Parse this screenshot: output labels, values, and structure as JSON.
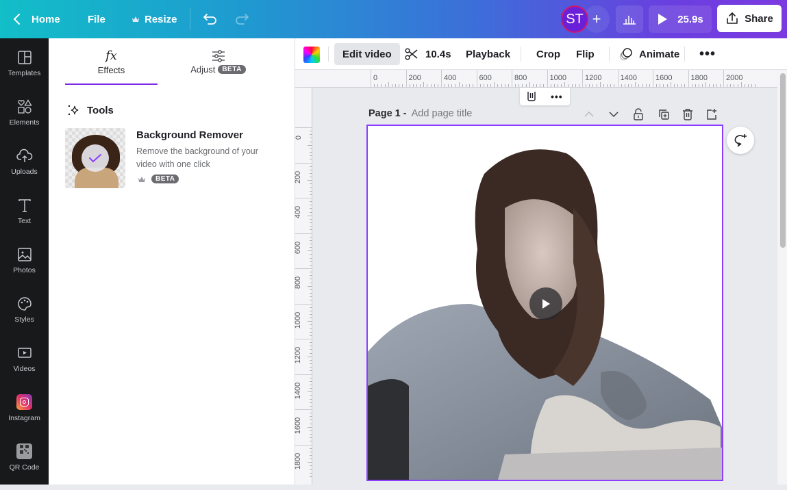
{
  "topbar": {
    "home_label": "Home",
    "file_label": "File",
    "resize_label": "Resize",
    "avatar_initials": "ST",
    "play_duration": "25.9s",
    "share_label": "Share"
  },
  "sidebar": {
    "items": [
      {
        "label": "Templates",
        "icon": "templates-icon"
      },
      {
        "label": "Elements",
        "icon": "elements-icon"
      },
      {
        "label": "Uploads",
        "icon": "upload-cloud-icon"
      },
      {
        "label": "Text",
        "icon": "text-icon"
      },
      {
        "label": "Photos",
        "icon": "photos-icon"
      },
      {
        "label": "Styles",
        "icon": "palette-icon"
      },
      {
        "label": "Videos",
        "icon": "video-icon"
      },
      {
        "label": "Instagram",
        "icon": "instagram-icon"
      },
      {
        "label": "QR Code",
        "icon": "qr-code-icon"
      }
    ]
  },
  "panel": {
    "tabs": [
      {
        "label": "Effects",
        "icon": "fx-icon",
        "active": true
      },
      {
        "label": "Adjust",
        "icon": "sliders-icon",
        "badge": "BETA",
        "active": false
      }
    ],
    "section_title": "Tools",
    "tool": {
      "title": "Background Remover",
      "description_line1": "Remove the background of your",
      "description_line2": "video with one click",
      "badge": "BETA"
    }
  },
  "context_bar": {
    "edit_video": "Edit video",
    "trim_duration": "10.4s",
    "playback": "Playback",
    "crop": "Crop",
    "flip": "Flip",
    "animate": "Animate"
  },
  "rulers": {
    "horizontal": [
      "0",
      "200",
      "400",
      "600",
      "800",
      "1000",
      "1200",
      "1400",
      "1600",
      "1800",
      "2000"
    ],
    "vertical": [
      "0",
      "200",
      "400",
      "600",
      "800",
      "1000",
      "1200",
      "1400",
      "1600",
      "1800"
    ]
  },
  "page": {
    "label": "Page 1 -",
    "title_placeholder": "Add page title"
  },
  "colors": {
    "accent": "#8b3dff",
    "sidebar_bg": "#18191b"
  }
}
